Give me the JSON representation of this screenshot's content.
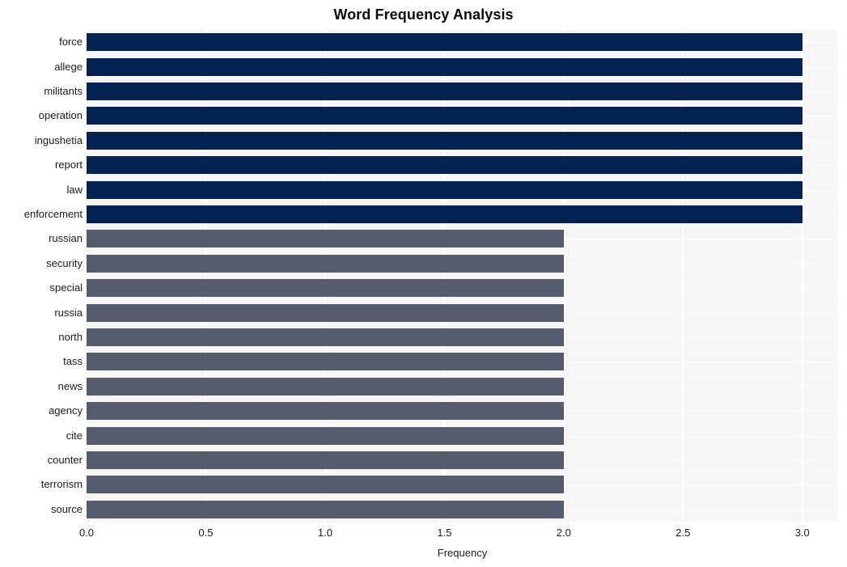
{
  "chart_data": {
    "type": "bar",
    "orientation": "horizontal",
    "title": "Word Frequency Analysis",
    "xlabel": "Frequency",
    "ylabel": "",
    "xlim": [
      0.0,
      3.15
    ],
    "xticks": [
      "0.0",
      "0.5",
      "1.0",
      "1.5",
      "2.0",
      "2.5",
      "3.0"
    ],
    "xtick_values": [
      0.0,
      0.5,
      1.0,
      1.5,
      2.0,
      2.5,
      3.0
    ],
    "grid": true,
    "legend": "none",
    "categories": [
      "force",
      "allege",
      "militants",
      "operation",
      "ingushetia",
      "report",
      "law",
      "enforcement",
      "russian",
      "security",
      "special",
      "russia",
      "north",
      "tass",
      "news",
      "agency",
      "cite",
      "counter",
      "terrorism",
      "source"
    ],
    "values": [
      3,
      3,
      3,
      3,
      3,
      3,
      3,
      3,
      2,
      2,
      2,
      2,
      2,
      2,
      2,
      2,
      2,
      2,
      2,
      2
    ],
    "bar_colors": [
      "#042352",
      "#042352",
      "#042352",
      "#042352",
      "#042352",
      "#042352",
      "#042352",
      "#042352",
      "#555c6e",
      "#555c6e",
      "#555c6e",
      "#555c6e",
      "#555c6e",
      "#555c6e",
      "#555c6e",
      "#555c6e",
      "#555c6e",
      "#555c6e",
      "#555c6e",
      "#555c6e"
    ],
    "colors": {
      "high_frequency": "#042352",
      "low_frequency": "#555c6e",
      "plot_background": "#f6f6f7",
      "gridline": "#ffffff",
      "figure_background": "#ffffff",
      "text": "#1b1b1b"
    }
  }
}
